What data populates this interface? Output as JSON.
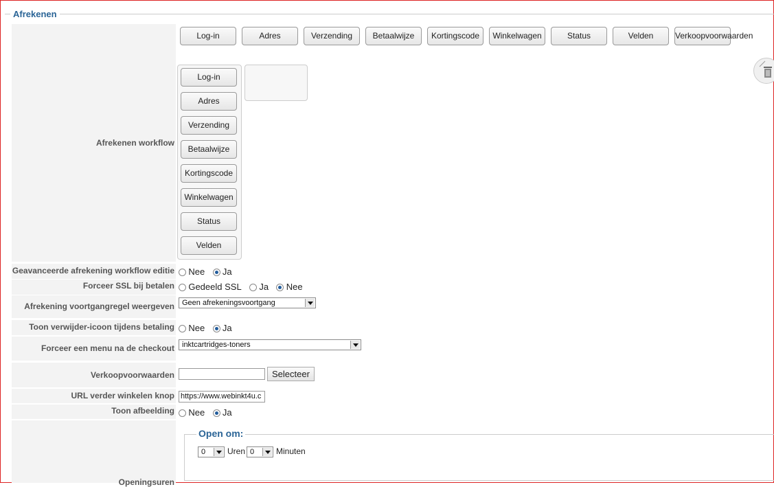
{
  "section_title": "Afrekenen",
  "workflow": {
    "label": "Afrekenen workflow",
    "top_buttons": [
      "Log-in",
      "Adres",
      "Verzending",
      "Betaalwijze",
      "Kortingscode",
      "Winkelwagen",
      "Status",
      "Velden",
      "Verkoopvoorwaarden"
    ],
    "column_buttons": [
      "Log-in",
      "Adres",
      "Verzending",
      "Betaalwijze",
      "Kortingscode",
      "Winkelwagen",
      "Status",
      "Velden"
    ]
  },
  "advanced_workflow": {
    "label": "Geavanceerde afrekening workflow editie",
    "options": [
      "Nee",
      "Ja"
    ],
    "selected": "Ja"
  },
  "force_ssl": {
    "label": "Forceer SSL bij betalen",
    "options": [
      "Gedeeld SSL",
      "Ja",
      "Nee"
    ],
    "selected": "Nee"
  },
  "progress_bar": {
    "label": "Afrekening voortgangregel weergeven",
    "value": "Geen afrekeningsvoortgang"
  },
  "delete_icon": {
    "label": "Toon verwijder-icoon tijdens betaling",
    "options": [
      "Nee",
      "Ja"
    ],
    "selected": "Ja"
  },
  "force_menu": {
    "label": "Forceer een menu na de checkout",
    "value": "inktcartridges-toners"
  },
  "terms": {
    "label": "Verkoopvoorwaarden",
    "value": "",
    "button": "Selecteer"
  },
  "continue_url": {
    "label": "URL verder winkelen knop",
    "value": "https://www.webinkt4u.c"
  },
  "show_image": {
    "label": "Toon afbeelding",
    "options": [
      "Nee",
      "Ja"
    ],
    "selected": "Ja"
  },
  "opening_hours": {
    "label": "Openingsuren",
    "legend": "Open om:",
    "hours_value": "0",
    "hours_label": "Uren",
    "minutes_value": "0",
    "minutes_label": "Minuten"
  }
}
